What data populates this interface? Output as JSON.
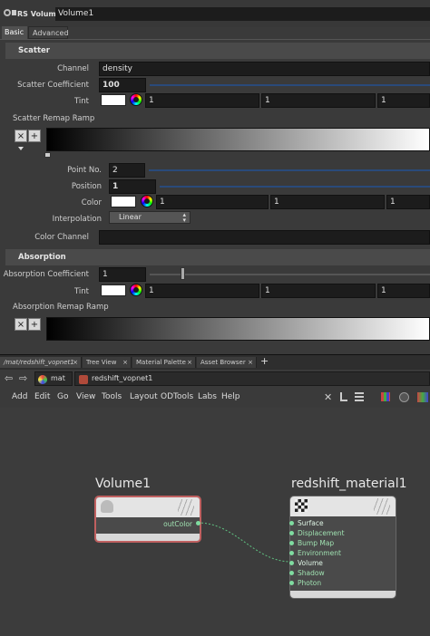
{
  "header": {
    "node_type": "RS Volume",
    "node_name": "Volume1"
  },
  "tabs": [
    "Basic",
    "Advanced"
  ],
  "scatter": {
    "title": "Scatter",
    "channel_label": "Channel",
    "channel_value": "density",
    "coeff_label": "Scatter Coefficient",
    "coeff_value": "100",
    "tint_label": "Tint",
    "tint_r": "1",
    "tint_g": "1",
    "tint_b": "1",
    "remap_label": "Scatter Remap Ramp",
    "point_label": "Point No.",
    "point_value": "2",
    "position_label": "Position",
    "position_value": "1",
    "color_label": "Color",
    "color_r": "1",
    "color_g": "1",
    "color_b": "1",
    "interp_label": "Interpolation",
    "interp_value": "Linear",
    "channel2_label": "Color Channel"
  },
  "absorption": {
    "title": "Absorption",
    "coeff_label": "Absorption Coefficient",
    "coeff_value": "1",
    "tint_label": "Tint",
    "tint_r": "1",
    "tint_g": "1",
    "tint_b": "1",
    "remap_label": "Absorption Remap Ramp"
  },
  "pane_tabs": [
    "/mat/redshift_vopnet1",
    "Tree View",
    "Material Palette",
    "Asset Browser"
  ],
  "path": {
    "mat": "mat",
    "vopnet": "redshift_vopnet1"
  },
  "menu": [
    "Add",
    "Edit",
    "Go",
    "View",
    "Tools",
    "Layout",
    "ODTools",
    "Labs",
    "Help"
  ],
  "nodes": {
    "volume": {
      "name": "Volume1",
      "output": "outColor"
    },
    "material": {
      "name": "redshift_material1",
      "inputs": [
        "Surface",
        "Displacement",
        "Bump Map",
        "Environment",
        "Volume",
        "Shadow",
        "Photon"
      ]
    }
  },
  "colors": {
    "accent_track": "#2a4a7a",
    "wire": "#5fc080",
    "port": "#7fdca0",
    "node_selected_border": "#c06060"
  }
}
